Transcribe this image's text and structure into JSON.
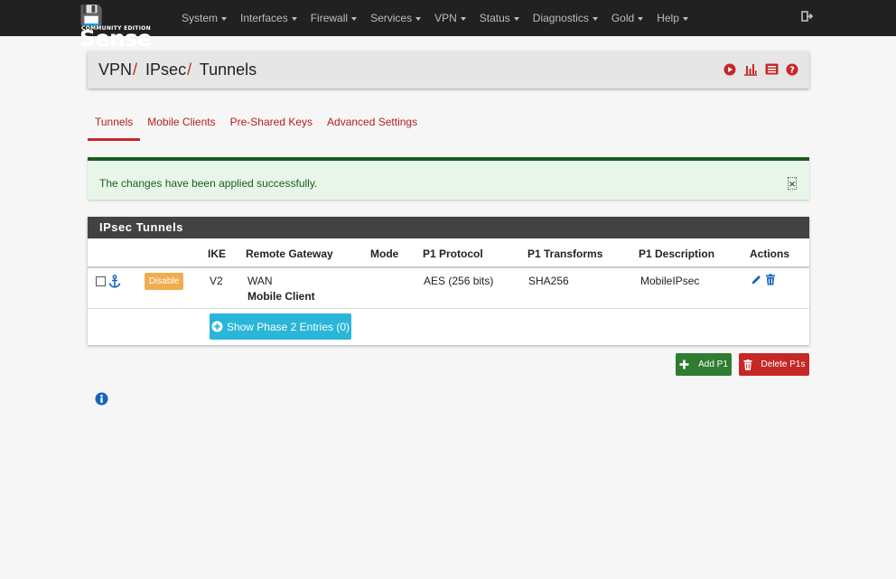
{
  "brand": {
    "name": "Sense",
    "edition": "COMMUNITY EDITION"
  },
  "nav": [
    {
      "label": "System"
    },
    {
      "label": "Interfaces"
    },
    {
      "label": "Firewall"
    },
    {
      "label": "Services"
    },
    {
      "label": "VPN"
    },
    {
      "label": "Status"
    },
    {
      "label": "Diagnostics"
    },
    {
      "label": "Gold"
    },
    {
      "label": "Help"
    }
  ],
  "breadcrumb": {
    "part1": "VPN",
    "part2": "IPsec",
    "part3": "Tunnels",
    "separator": "/"
  },
  "tabs": [
    {
      "label": "Tunnels",
      "active": true
    },
    {
      "label": "Mobile Clients"
    },
    {
      "label": "Pre-Shared Keys"
    },
    {
      "label": "Advanced Settings"
    }
  ],
  "alert": {
    "message": "The changes have been applied successfully.",
    "close": "×"
  },
  "panel": {
    "title": "IPsec Tunnels",
    "columns": {
      "ike": "IKE",
      "remote_gateway": "Remote Gateway",
      "mode": "Mode",
      "p1_protocol": "P1 Protocol",
      "p1_transforms": "P1 Transforms",
      "p1_description": "P1 Description",
      "actions": "Actions"
    },
    "row": {
      "disable_label": "Disable",
      "ike": "V2",
      "gateway": "WAN",
      "gateway_sub": "Mobile Client",
      "mode": "",
      "p1_protocol": "AES (256 bits)",
      "p1_transforms": "SHA256",
      "p1_description": "MobileIPsec"
    },
    "phase2_button": "Show Phase 2 Entries (0)"
  },
  "buttons": {
    "add": "Add P1",
    "delete": "Delete P1s"
  },
  "colors": {
    "navbar": "#212121",
    "accent_red": "#c62828",
    "success_green": "#2e7d32",
    "warning_orange": "#f0ad4e",
    "info_blue": "#1565c0",
    "phase2_teal": "#29b6d8"
  },
  "icons": [
    "logout-icon",
    "play-circle-icon",
    "bar-chart-icon",
    "list-icon",
    "help-icon",
    "anchor-icon",
    "pencil-icon",
    "trash-icon",
    "plus-icon",
    "info-icon"
  ]
}
